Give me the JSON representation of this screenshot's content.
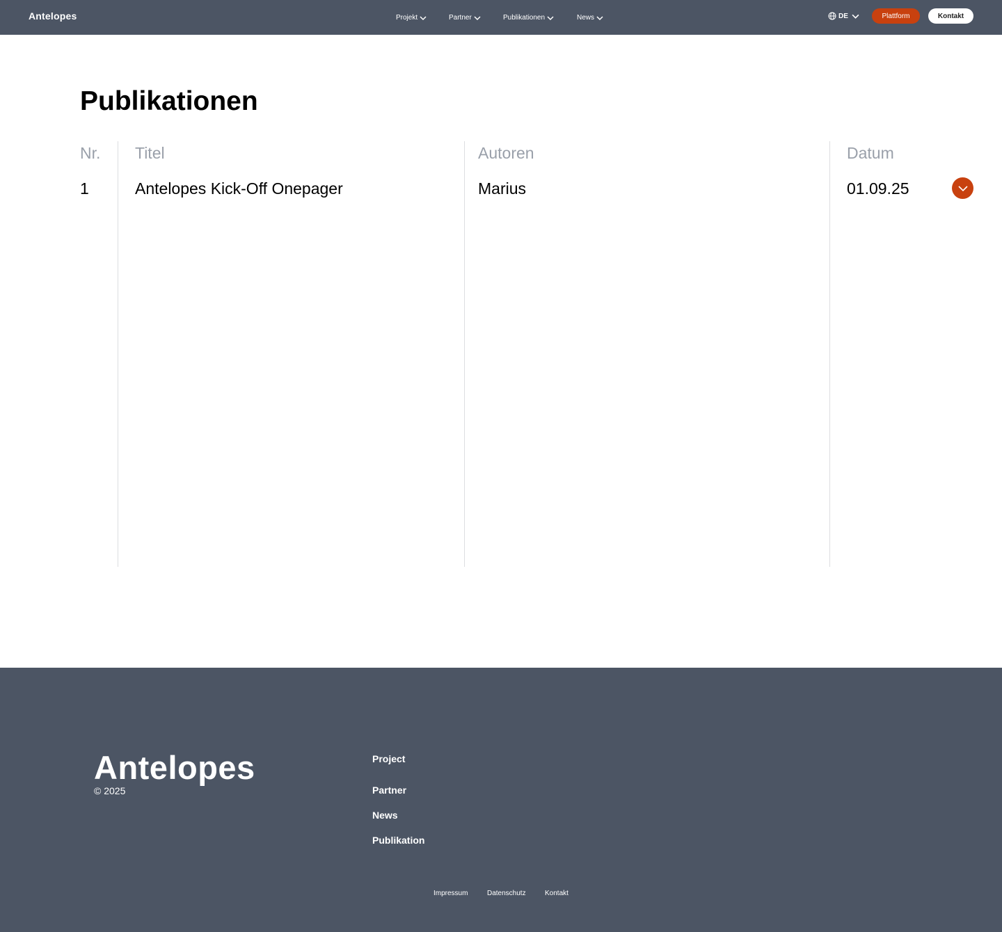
{
  "navbar": {
    "brand": "Antelopes",
    "items": [
      {
        "label": "Projekt"
      },
      {
        "label": "Partner"
      },
      {
        "label": "Publikationen"
      },
      {
        "label": "News"
      }
    ],
    "language": "DE",
    "plattform_label": "Plattform",
    "kontakt_label": "Kontakt"
  },
  "main": {
    "title": "Publikationen",
    "columns": [
      "Nr.",
      "Titel",
      "Autoren",
      "Datum"
    ],
    "rows": [
      {
        "nr": "1",
        "titel": "Antelopes Kick-Off Onepager",
        "autoren": "Marius",
        "datum": "01.09.25"
      }
    ]
  },
  "footer": {
    "logo": "Antelopes",
    "copyright": "© 2025",
    "links": [
      "Project",
      "Partner",
      "News",
      "Publikation"
    ],
    "legal": [
      "Impressum",
      "Datenschutz",
      "Kontakt"
    ]
  },
  "colors": {
    "navbar_bg": "#4c5564",
    "accent": "#c8410f",
    "header_text": "#9aa0aa"
  }
}
